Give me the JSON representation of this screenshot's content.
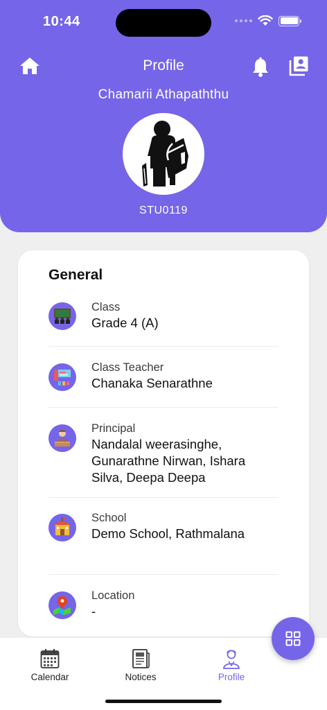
{
  "status_bar": {
    "time": "10:44"
  },
  "header": {
    "title": "Profile",
    "student_name": "Chamarii Athapaththu",
    "student_id": "STU0119"
  },
  "general": {
    "title": "General",
    "rows": [
      {
        "label": "Class",
        "value": "Grade 4 (A)"
      },
      {
        "label": "Class Teacher",
        "value": "Chanaka Senarathne"
      },
      {
        "label": "Principal",
        "value": "Nandalal weerasinghe, Gunarathne Nirwan, Ishara Silva, Deepa Deepa"
      },
      {
        "label": "School",
        "value": "Demo School, Rathmalana"
      },
      {
        "label": "Location",
        "value": "-"
      }
    ]
  },
  "bottom_nav": {
    "items": [
      {
        "label": "Calendar",
        "icon": "calendar-icon"
      },
      {
        "label": "Notices",
        "icon": "notices-icon"
      },
      {
        "label": "Profile",
        "icon": "profile-icon",
        "active": true
      }
    ]
  },
  "colors": {
    "accent": "#7565e8",
    "background": "#efefef",
    "card": "#ffffff"
  }
}
